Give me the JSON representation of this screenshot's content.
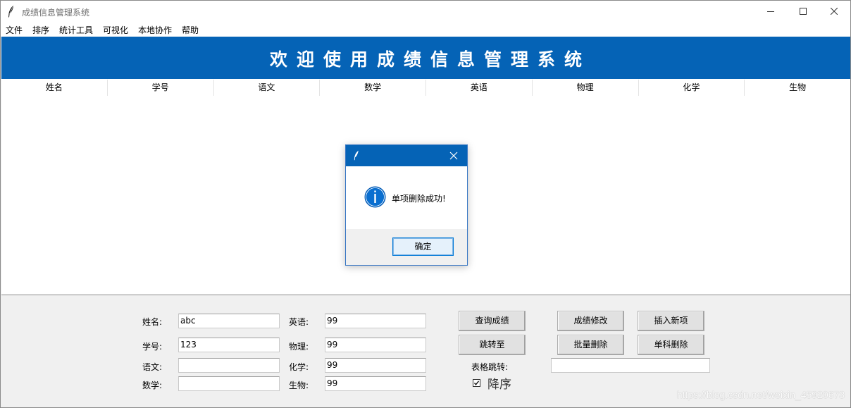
{
  "window": {
    "title": "成绩信息管理系统",
    "icon": "feather-icon",
    "controls": [
      "minimize-icon",
      "maximize-icon",
      "close-icon"
    ]
  },
  "menu": [
    "文件",
    "排序",
    "统计工具",
    "可视化",
    "本地协作",
    "帮助"
  ],
  "banner": {
    "text": "欢迎使用成绩信息管理系统",
    "background": "#0563b6"
  },
  "table": {
    "columns": [
      "姓名",
      "学号",
      "语文",
      "数学",
      "英语",
      "物理",
      "化学",
      "生物"
    ],
    "rows": []
  },
  "form": {
    "name": {
      "label": "姓名:",
      "value": "abc"
    },
    "id": {
      "label": "学号:",
      "value": "123"
    },
    "chinese": {
      "label": "语文:",
      "value": ""
    },
    "math": {
      "label": "数学:",
      "value": ""
    },
    "english": {
      "label": "英语:",
      "value": "99"
    },
    "physics": {
      "label": "物理:",
      "value": "99"
    },
    "chemistry": {
      "label": "化学:",
      "value": "99"
    },
    "biology": {
      "label": "生物:",
      "value": "99"
    },
    "jump": {
      "label": "表格跳转:",
      "value": ""
    },
    "descending": {
      "label": "降序",
      "checked": true
    }
  },
  "buttons": {
    "query": "查询成绩",
    "jump_to": "跳转至",
    "modify": "成绩修改",
    "batch_delete": "批量删除",
    "insert": "插入新项",
    "single_delete": "单科删除"
  },
  "dialog": {
    "message": "单项删除成功!",
    "ok_label": "确定",
    "icon": "info-icon"
  },
  "watermark": "https://blog.csdn.net/weixin_45920673",
  "colors": {
    "accent": "#0563b6",
    "info": "#0a6fd0"
  }
}
